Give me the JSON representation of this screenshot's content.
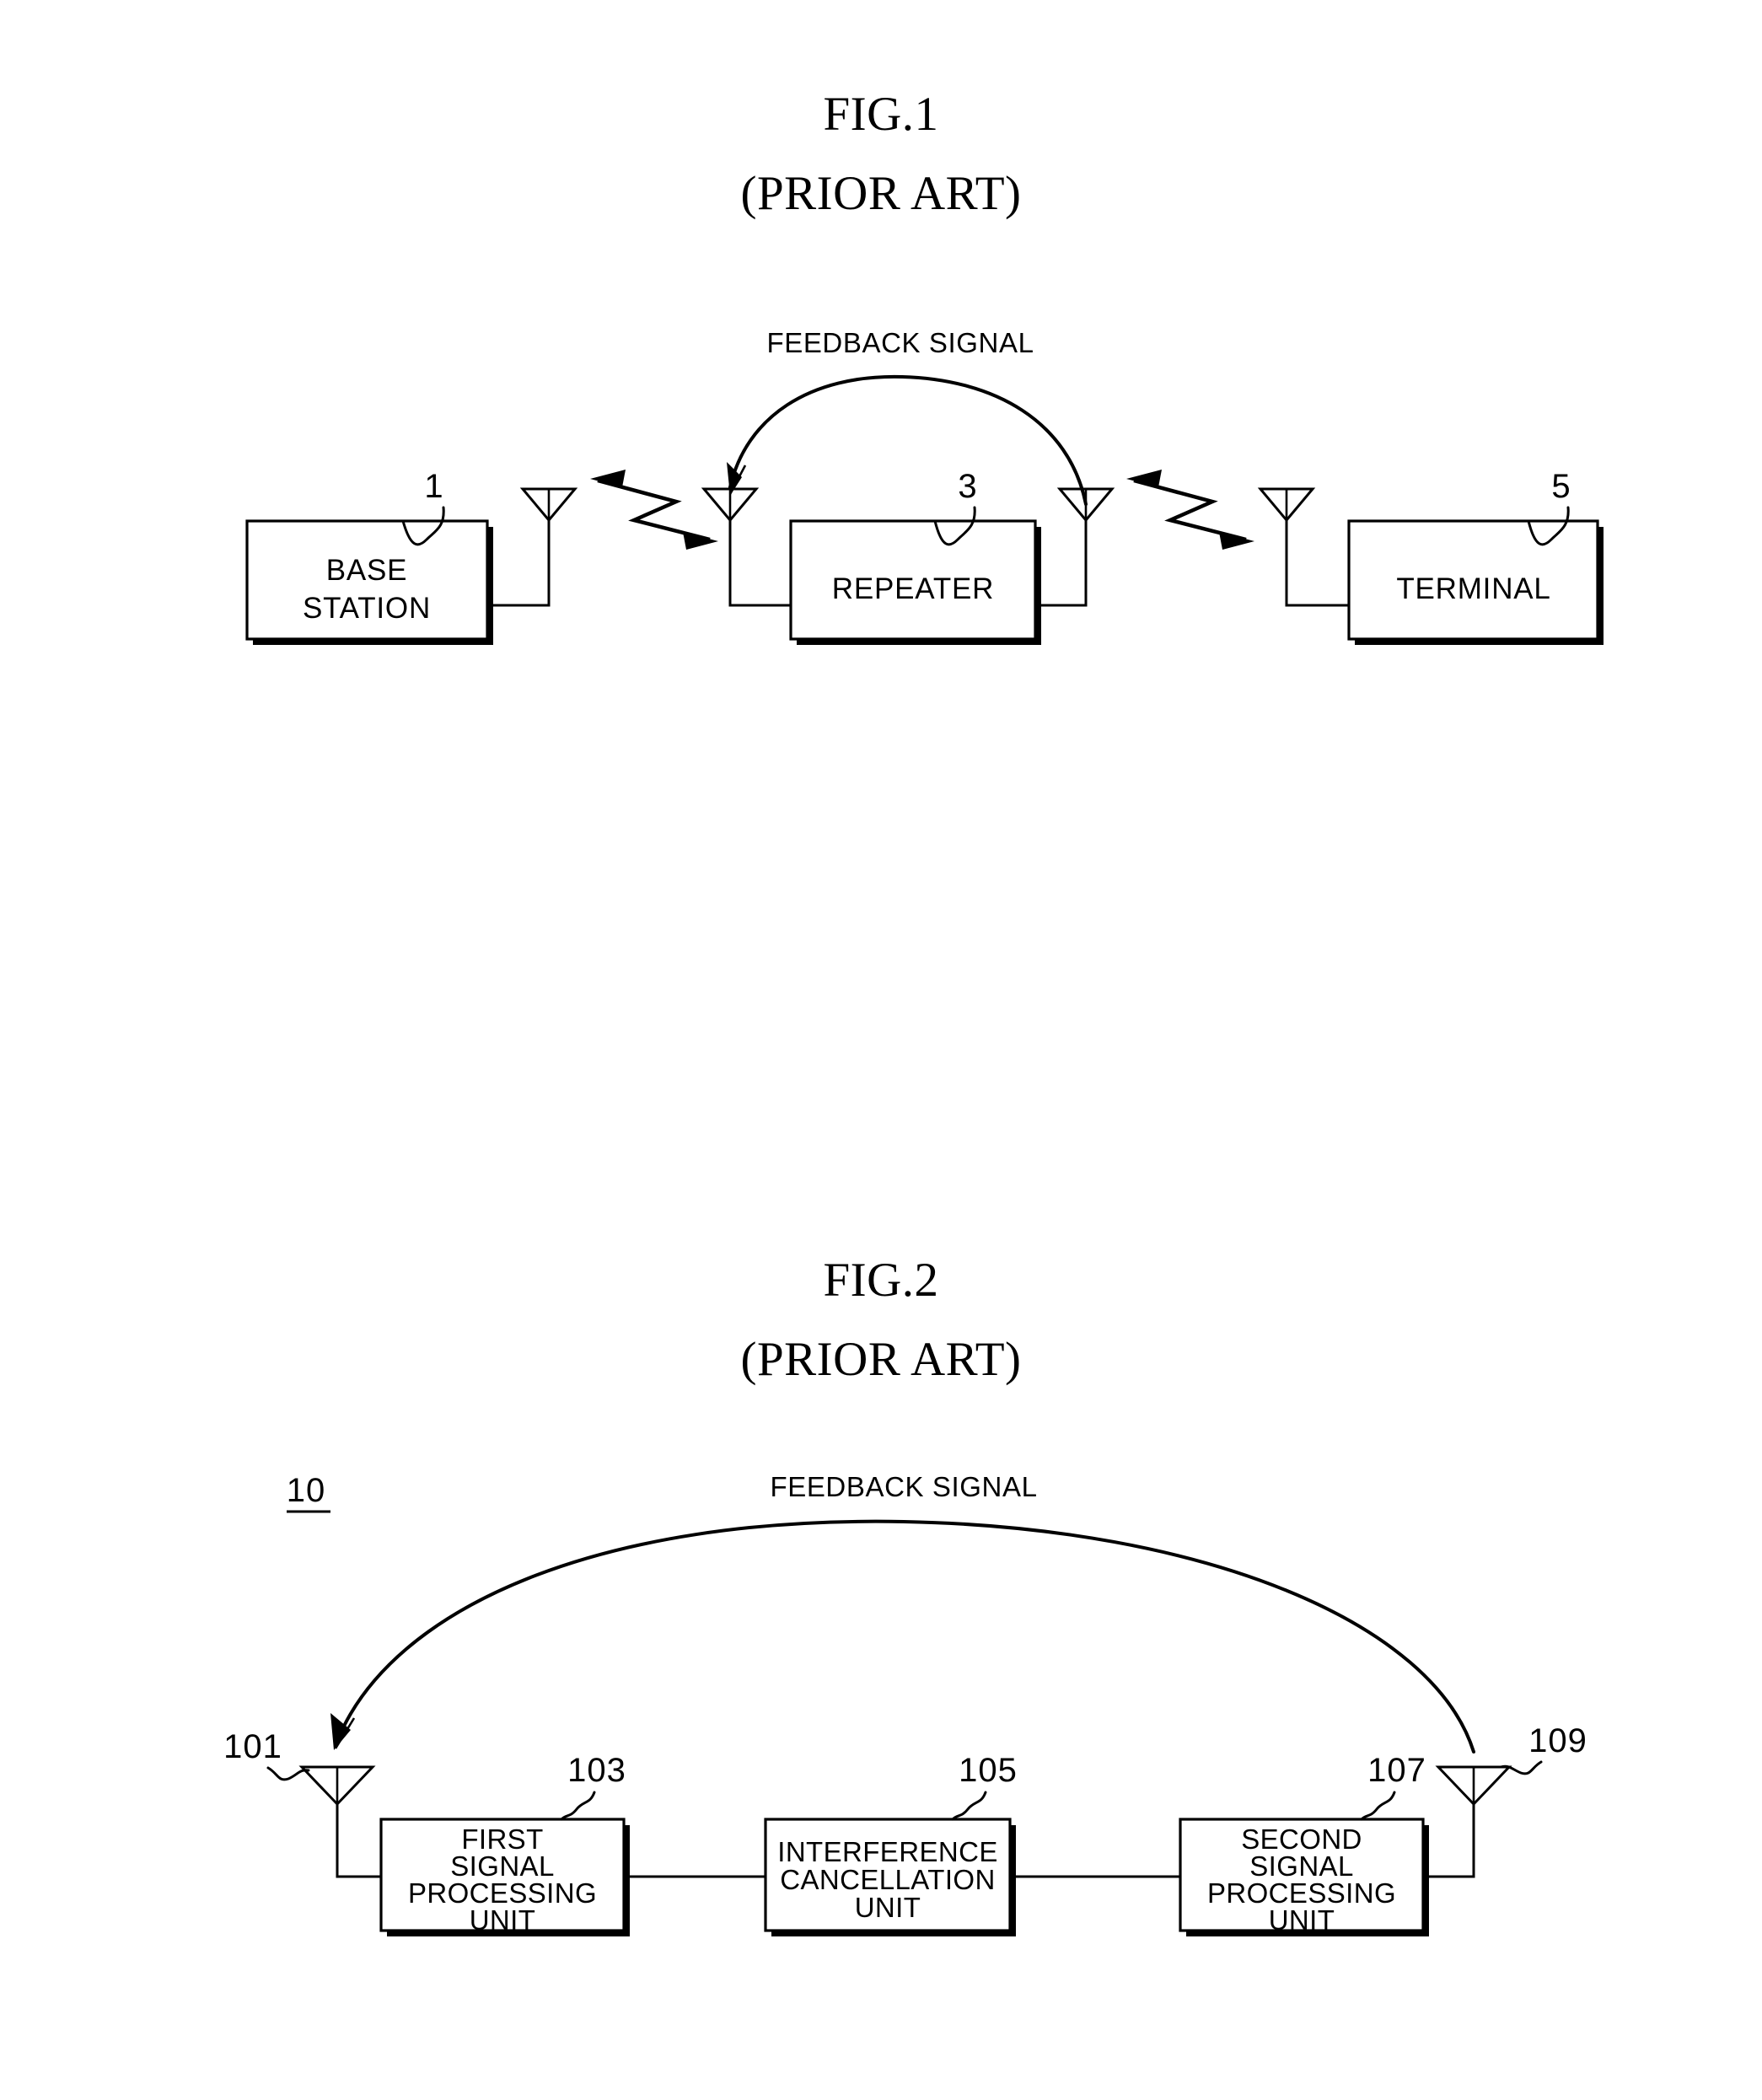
{
  "figures": [
    {
      "id": "fig1",
      "title_line1": "FIG.1",
      "title_line2": "(PRIOR ART)",
      "feedback_label": "FEEDBACK SIGNAL",
      "boxes": [
        {
          "id": "base-station",
          "label_line1": "BASE",
          "label_line2": "STATION",
          "numeral": "1"
        },
        {
          "id": "repeater",
          "label_line1": "REPEATER",
          "label_line2": "",
          "numeral": "3"
        },
        {
          "id": "terminal",
          "label_line1": "TERMINAL",
          "label_line2": "",
          "numeral": "5"
        }
      ],
      "antennas": [
        "antenna-base",
        "antenna-repeater-in",
        "antenna-repeater-out",
        "antenna-terminal"
      ],
      "links": [
        "base-to-repeater",
        "repeater-to-terminal"
      ]
    },
    {
      "id": "fig2",
      "title_line1": "FIG.2",
      "title_line2": "(PRIOR ART)",
      "feedback_label": "FEEDBACK SIGNAL",
      "system_numeral": "10",
      "boxes": [
        {
          "id": "first-signal-processing-unit",
          "line1": "FIRST",
          "line2": "SIGNAL",
          "line3": "PROCESSING",
          "line4": "UNIT",
          "numeral": "103"
        },
        {
          "id": "interference-cancellation-unit",
          "line1": "INTERFERENCE",
          "line2": "CANCELLATION",
          "line3": "UNIT",
          "line4": "",
          "numeral": "105"
        },
        {
          "id": "second-signal-processing-unit",
          "line1": "SECOND",
          "line2": "SIGNAL",
          "line3": "PROCESSING",
          "line4": "UNIT",
          "numeral": "107"
        }
      ],
      "antennas": [
        {
          "id": "input-antenna",
          "numeral": "101"
        },
        {
          "id": "output-antenna",
          "numeral": "109"
        }
      ]
    }
  ],
  "colors": {
    "ink": "#000000",
    "paper": "#ffffff"
  }
}
